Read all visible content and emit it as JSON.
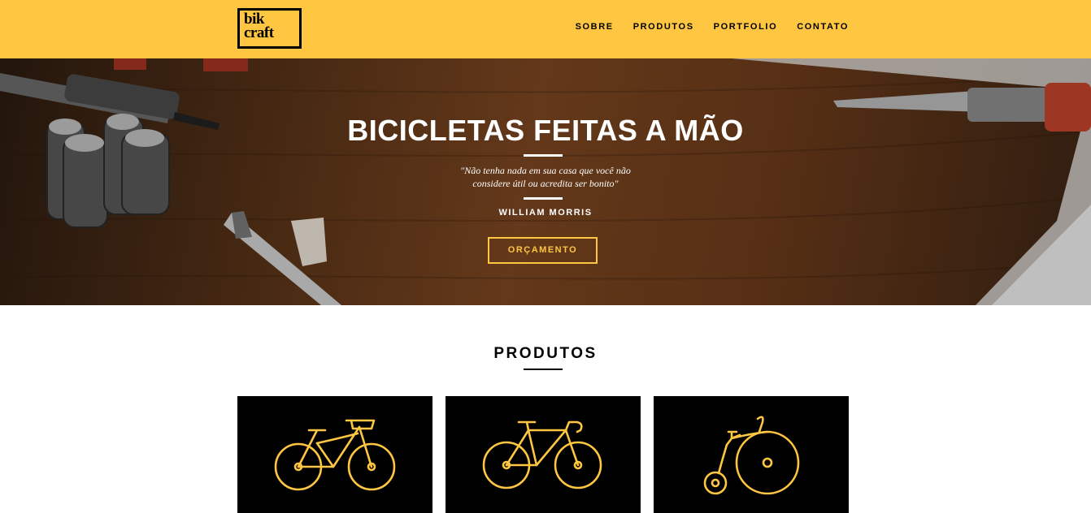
{
  "header": {
    "logo_line1": "bik",
    "logo_line2": "craft",
    "nav": [
      "SOBRE",
      "PRODUTOS",
      "PORTFOLIO",
      "CONTATO"
    ],
    "background_color": "#fec641"
  },
  "hero": {
    "title": "BICICLETAS FEITAS A MÃO",
    "quote_line1": "\"Não tenha nada em sua casa que você não",
    "quote_line2": "considere útil ou acredita ser bonito\"",
    "author": "WILLIAM MORRIS",
    "button_label": "ORÇAMENTO",
    "accent_color": "#fec641"
  },
  "products": {
    "title": "PRODUTOS",
    "cards": [
      {
        "icon": "city-bike-icon"
      },
      {
        "icon": "road-bike-icon"
      },
      {
        "icon": "penny-farthing-icon"
      }
    ]
  }
}
